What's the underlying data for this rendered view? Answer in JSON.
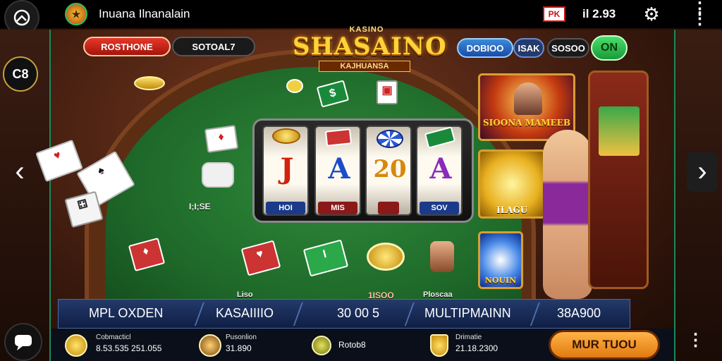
{
  "topbar": {
    "app_title": "Inuana Ilnanalain",
    "flag_text": "PK",
    "status_text": "il 2.93"
  },
  "left_badge": {
    "label": "C8"
  },
  "pills": {
    "left_red": "ROSTHONE",
    "left_dark": "SOTOAL7",
    "right_blue": "DOBIOO",
    "right_gold": "ISAK",
    "right_value": "SOSOO",
    "on_toggle": "ON"
  },
  "logo": {
    "top": "KASINO",
    "main": "SHASAINO",
    "sub": "KAJHUANSA"
  },
  "reels": {
    "symbols": [
      "J",
      "A",
      "20",
      "A"
    ],
    "labels": [
      "HOI",
      "MIS",
      "",
      "SOV"
    ],
    "colors": [
      "#d0220d",
      "#1b4cc8",
      "#d8870d",
      "#8a2bbb"
    ]
  },
  "felt_labels": {
    "left": "I;I;SE",
    "center_left": "Liso",
    "center": "1ISOO",
    "center_right": "Ploscaa"
  },
  "promos": {
    "top": "SIOONA MAMEEB",
    "middle": "ILAGU",
    "bottom": "NOUIN"
  },
  "stats": [
    "MPL OXDEN",
    "KASAIIIIO",
    "30 00 5",
    "MULTIPMAINN",
    "38A900"
  ],
  "info": [
    {
      "label": "Cobmacticl",
      "value": "8.53.535 251.055"
    },
    {
      "label": "Pusonlion",
      "value": "31.890"
    },
    {
      "label": "",
      "value": "Rotob8"
    },
    {
      "label": "Drimatie",
      "value": "21.18.2300"
    }
  ],
  "cta_label": "MUR TUOU",
  "colors": {
    "felt": "#2f8a3a",
    "accent_gold": "#ffd23a",
    "frame_green": "#1a8a5a",
    "cta": "#ffb347"
  }
}
